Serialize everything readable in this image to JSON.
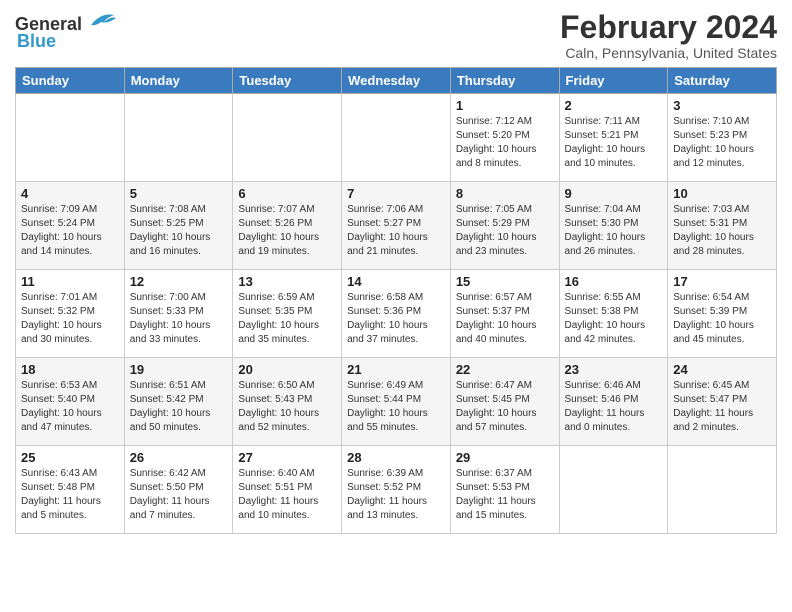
{
  "logo": {
    "general": "General",
    "blue": "Blue"
  },
  "header": {
    "month": "February 2024",
    "location": "Caln, Pennsylvania, United States"
  },
  "weekdays": [
    "Sunday",
    "Monday",
    "Tuesday",
    "Wednesday",
    "Thursday",
    "Friday",
    "Saturday"
  ],
  "weeks": [
    [
      {
        "day": "",
        "info": ""
      },
      {
        "day": "",
        "info": ""
      },
      {
        "day": "",
        "info": ""
      },
      {
        "day": "",
        "info": ""
      },
      {
        "day": "1",
        "info": "Sunrise: 7:12 AM\nSunset: 5:20 PM\nDaylight: 10 hours\nand 8 minutes."
      },
      {
        "day": "2",
        "info": "Sunrise: 7:11 AM\nSunset: 5:21 PM\nDaylight: 10 hours\nand 10 minutes."
      },
      {
        "day": "3",
        "info": "Sunrise: 7:10 AM\nSunset: 5:23 PM\nDaylight: 10 hours\nand 12 minutes."
      }
    ],
    [
      {
        "day": "4",
        "info": "Sunrise: 7:09 AM\nSunset: 5:24 PM\nDaylight: 10 hours\nand 14 minutes."
      },
      {
        "day": "5",
        "info": "Sunrise: 7:08 AM\nSunset: 5:25 PM\nDaylight: 10 hours\nand 16 minutes."
      },
      {
        "day": "6",
        "info": "Sunrise: 7:07 AM\nSunset: 5:26 PM\nDaylight: 10 hours\nand 19 minutes."
      },
      {
        "day": "7",
        "info": "Sunrise: 7:06 AM\nSunset: 5:27 PM\nDaylight: 10 hours\nand 21 minutes."
      },
      {
        "day": "8",
        "info": "Sunrise: 7:05 AM\nSunset: 5:29 PM\nDaylight: 10 hours\nand 23 minutes."
      },
      {
        "day": "9",
        "info": "Sunrise: 7:04 AM\nSunset: 5:30 PM\nDaylight: 10 hours\nand 26 minutes."
      },
      {
        "day": "10",
        "info": "Sunrise: 7:03 AM\nSunset: 5:31 PM\nDaylight: 10 hours\nand 28 minutes."
      }
    ],
    [
      {
        "day": "11",
        "info": "Sunrise: 7:01 AM\nSunset: 5:32 PM\nDaylight: 10 hours\nand 30 minutes."
      },
      {
        "day": "12",
        "info": "Sunrise: 7:00 AM\nSunset: 5:33 PM\nDaylight: 10 hours\nand 33 minutes."
      },
      {
        "day": "13",
        "info": "Sunrise: 6:59 AM\nSunset: 5:35 PM\nDaylight: 10 hours\nand 35 minutes."
      },
      {
        "day": "14",
        "info": "Sunrise: 6:58 AM\nSunset: 5:36 PM\nDaylight: 10 hours\nand 37 minutes."
      },
      {
        "day": "15",
        "info": "Sunrise: 6:57 AM\nSunset: 5:37 PM\nDaylight: 10 hours\nand 40 minutes."
      },
      {
        "day": "16",
        "info": "Sunrise: 6:55 AM\nSunset: 5:38 PM\nDaylight: 10 hours\nand 42 minutes."
      },
      {
        "day": "17",
        "info": "Sunrise: 6:54 AM\nSunset: 5:39 PM\nDaylight: 10 hours\nand 45 minutes."
      }
    ],
    [
      {
        "day": "18",
        "info": "Sunrise: 6:53 AM\nSunset: 5:40 PM\nDaylight: 10 hours\nand 47 minutes."
      },
      {
        "day": "19",
        "info": "Sunrise: 6:51 AM\nSunset: 5:42 PM\nDaylight: 10 hours\nand 50 minutes."
      },
      {
        "day": "20",
        "info": "Sunrise: 6:50 AM\nSunset: 5:43 PM\nDaylight: 10 hours\nand 52 minutes."
      },
      {
        "day": "21",
        "info": "Sunrise: 6:49 AM\nSunset: 5:44 PM\nDaylight: 10 hours\nand 55 minutes."
      },
      {
        "day": "22",
        "info": "Sunrise: 6:47 AM\nSunset: 5:45 PM\nDaylight: 10 hours\nand 57 minutes."
      },
      {
        "day": "23",
        "info": "Sunrise: 6:46 AM\nSunset: 5:46 PM\nDaylight: 11 hours\nand 0 minutes."
      },
      {
        "day": "24",
        "info": "Sunrise: 6:45 AM\nSunset: 5:47 PM\nDaylight: 11 hours\nand 2 minutes."
      }
    ],
    [
      {
        "day": "25",
        "info": "Sunrise: 6:43 AM\nSunset: 5:48 PM\nDaylight: 11 hours\nand 5 minutes."
      },
      {
        "day": "26",
        "info": "Sunrise: 6:42 AM\nSunset: 5:50 PM\nDaylight: 11 hours\nand 7 minutes."
      },
      {
        "day": "27",
        "info": "Sunrise: 6:40 AM\nSunset: 5:51 PM\nDaylight: 11 hours\nand 10 minutes."
      },
      {
        "day": "28",
        "info": "Sunrise: 6:39 AM\nSunset: 5:52 PM\nDaylight: 11 hours\nand 13 minutes."
      },
      {
        "day": "29",
        "info": "Sunrise: 6:37 AM\nSunset: 5:53 PM\nDaylight: 11 hours\nand 15 minutes."
      },
      {
        "day": "",
        "info": ""
      },
      {
        "day": "",
        "info": ""
      }
    ]
  ]
}
